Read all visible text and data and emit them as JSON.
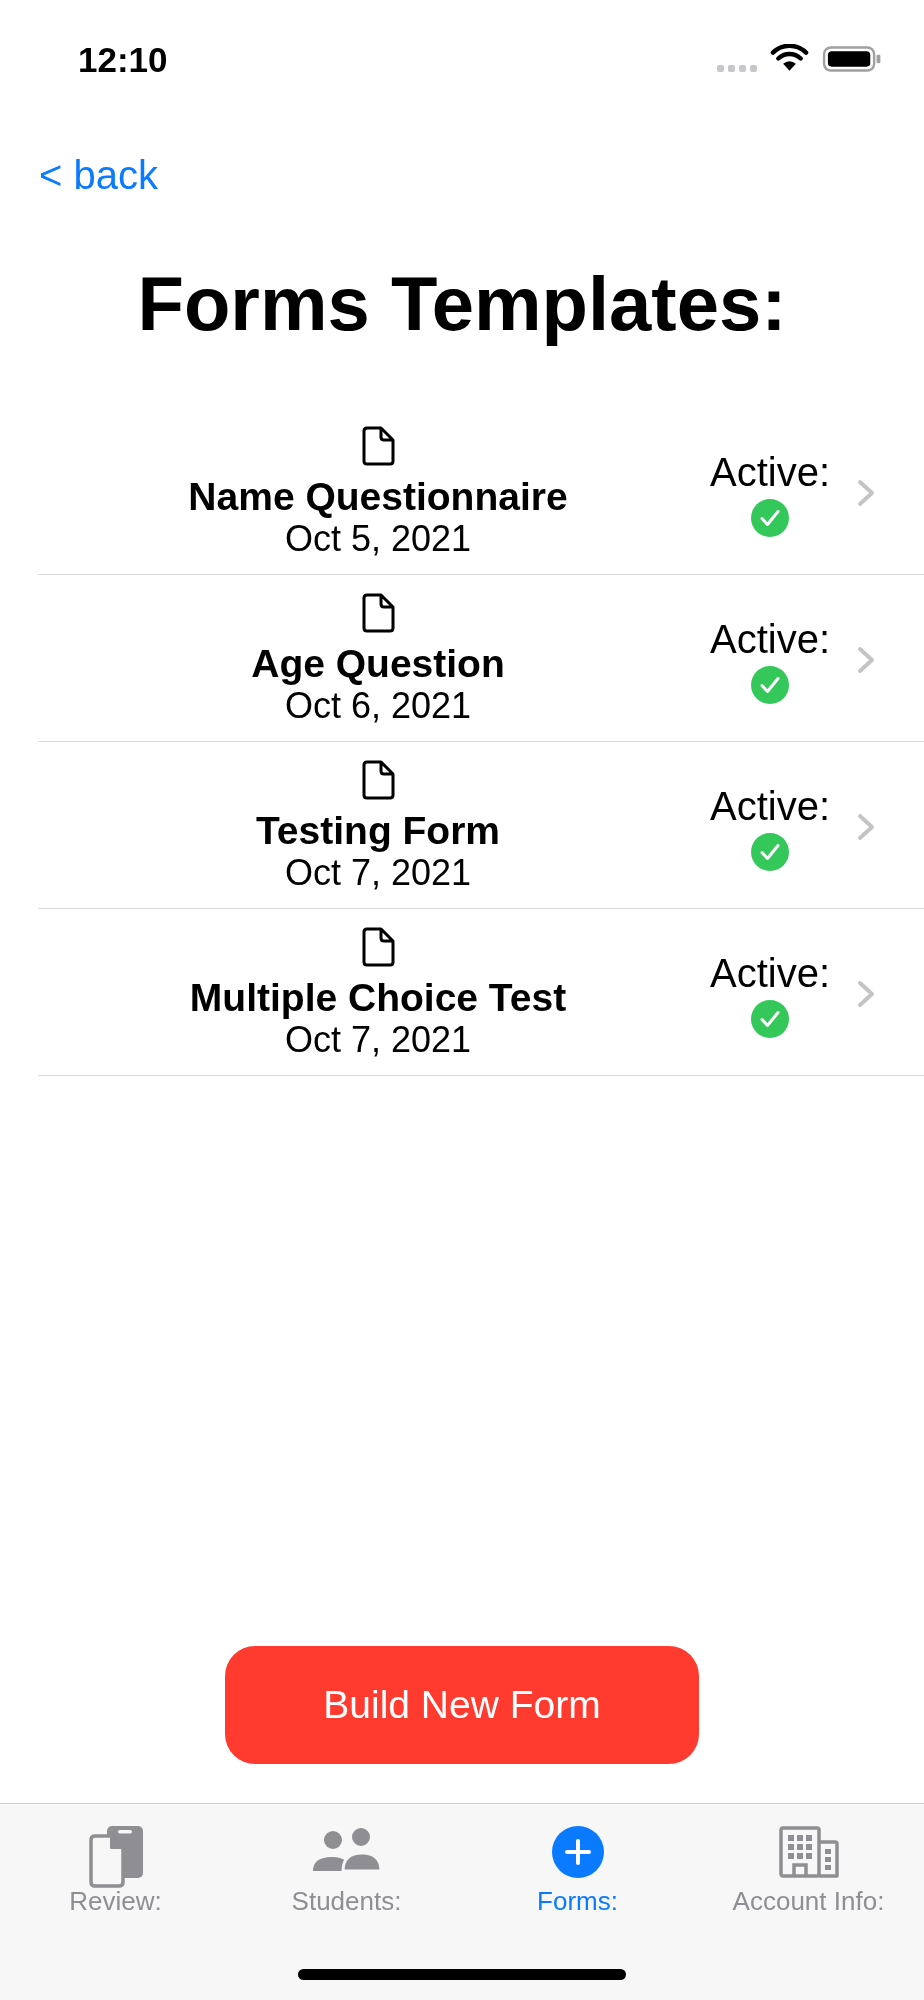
{
  "status_bar": {
    "time": "12:10"
  },
  "navigation": {
    "back": "< back"
  },
  "title": "Forms Templates:",
  "forms": [
    {
      "name": "Name Questionnaire",
      "date": "Oct 5, 2021",
      "status_label": "Active:",
      "active": true
    },
    {
      "name": "Age Question",
      "date": "Oct 6, 2021",
      "status_label": "Active:",
      "active": true
    },
    {
      "name": "Testing Form",
      "date": "Oct 7, 2021",
      "status_label": "Active:",
      "active": true
    },
    {
      "name": "Multiple Choice Test",
      "date": "Oct 7, 2021",
      "status_label": "Active:",
      "active": true
    }
  ],
  "build_button": {
    "label": "Build New Form"
  },
  "tab_bar": {
    "tabs": [
      {
        "kind": "review",
        "label": "Review:",
        "selected": false
      },
      {
        "kind": "students",
        "label": "Students:",
        "selected": false
      },
      {
        "kind": "forms",
        "label": "Forms:",
        "selected": true
      },
      {
        "kind": "account",
        "label": "Account Info:",
        "selected": false
      }
    ]
  }
}
